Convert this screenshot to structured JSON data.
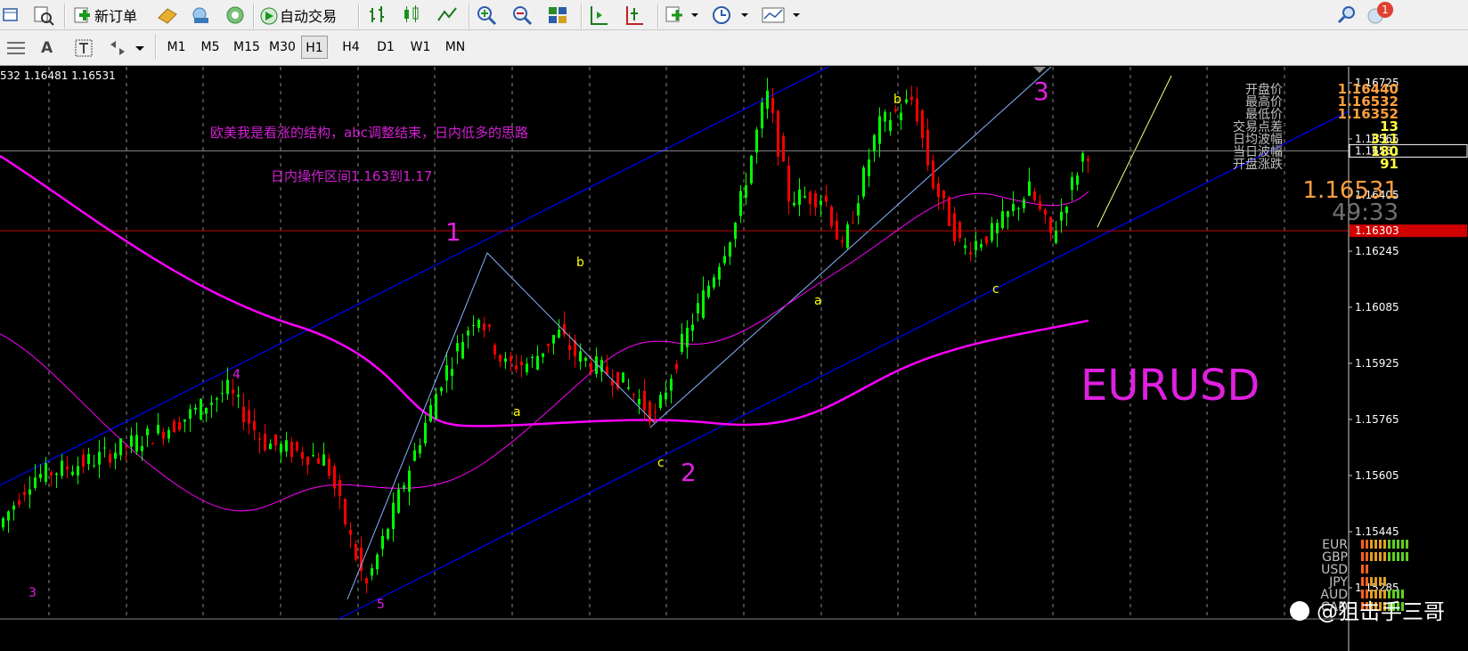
{
  "toolbar": {
    "new_order": "新订单",
    "auto_trading": "自动交易",
    "notification_badge": "1"
  },
  "timeframes": [
    "M1",
    "M5",
    "M15",
    "M30",
    "H1",
    "H4",
    "D1",
    "W1",
    "MN"
  ],
  "selected_timeframe": "H1",
  "chart": {
    "header_prices": "532 1.16481 1.16531",
    "symbol": "EURUSD",
    "annotation_1": "欧美我是看涨的结构，abc调整结束，日内低多的思路",
    "annotation_2": "日内操作区间1.163到1.17",
    "price_axis": [
      "1.16725",
      "1.16565",
      "1.16405",
      "1.16245",
      "1.16085",
      "1.15925",
      "1.15765",
      "1.15605",
      "1.15445",
      "1.15285"
    ],
    "current_price_tag": "1.16531",
    "line_price_tag": "1.16303",
    "big_price": "1.16531",
    "countdown": "49:33",
    "stats": [
      {
        "label": "开盘价",
        "value": "1.16440"
      },
      {
        "label": "最高价",
        "value": "1.16532"
      },
      {
        "label": "最低价",
        "value": "1.16352"
      },
      {
        "label": "交易点差",
        "value": "13"
      },
      {
        "label": "日均波幅",
        "value": "311"
      },
      {
        "label": "当日波幅",
        "value": "180"
      },
      {
        "label": "开盘涨跌",
        "value": "91"
      }
    ],
    "currencies": [
      "EUR",
      "GBP",
      "USD",
      "JPY",
      "AUD",
      "CAD"
    ],
    "wave_labels": {
      "w1": "1",
      "w2": "2",
      "w3": "3",
      "w3_left": "3",
      "w4": "4",
      "w5": "5",
      "a1": "a",
      "b1": "b",
      "c1": "c",
      "a2": "a",
      "b2": "b",
      "c2": "c"
    },
    "watermark": "@狙击手三哥",
    "colors": {
      "background": "#000000",
      "bull": "#00ff00",
      "bear": "#ff0000",
      "ma": "#ff00ff",
      "channel": "#0000ff",
      "wave": "#ffff00"
    }
  }
}
